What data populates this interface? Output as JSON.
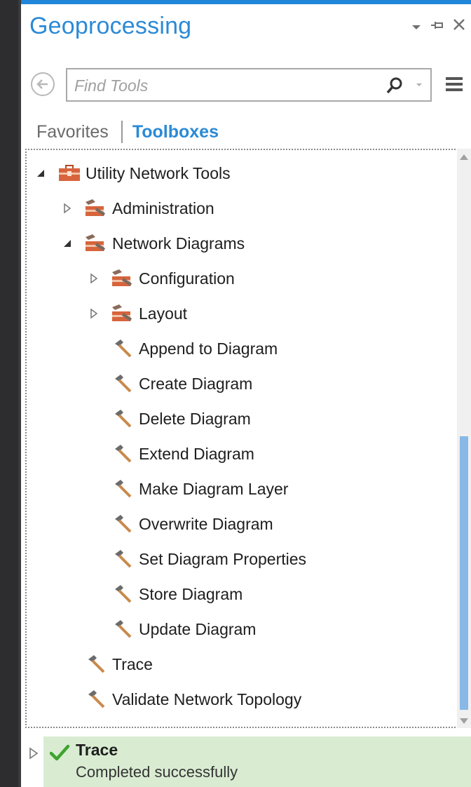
{
  "app": {
    "title": "Geoprocessing"
  },
  "search": {
    "placeholder": "Find Tools",
    "value": ""
  },
  "tabs": {
    "favorites": "Favorites",
    "toolboxes": "Toolboxes"
  },
  "colors": {
    "accent": "#2b8ad6",
    "status_bg": "#d9ecd2",
    "check_green": "#3fa32f"
  },
  "tree": {
    "root": "Utility Network Tools",
    "administration": "Administration",
    "network_diagrams": "Network Diagrams",
    "configuration": "Configuration",
    "layout": "Layout",
    "nd_tools": [
      "Append to Diagram",
      "Create Diagram",
      "Delete Diagram",
      "Extend Diagram",
      "Make Diagram Layer",
      "Overwrite Diagram",
      "Set Diagram Properties",
      "Store Diagram",
      "Update Diagram"
    ],
    "trace": "Trace",
    "validate": "Validate Network Topology"
  },
  "status": {
    "title": "Trace",
    "message": "Completed successfully"
  }
}
